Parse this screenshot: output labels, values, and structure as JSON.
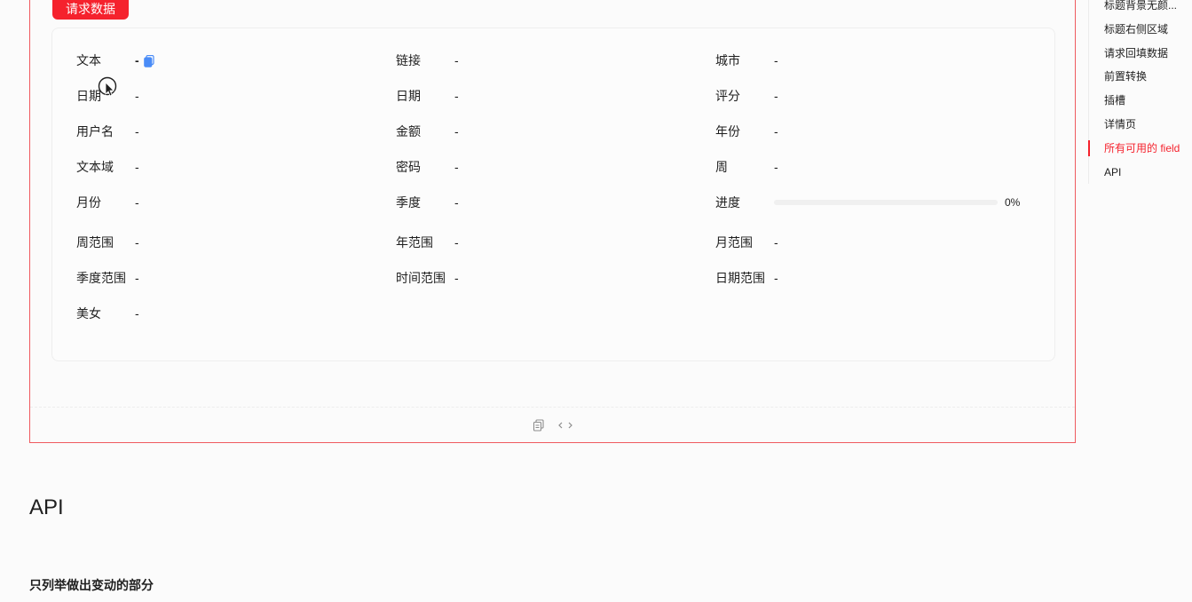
{
  "demo": {
    "request_button": "请求数据",
    "fields": [
      {
        "label": "文本",
        "value": "-"
      },
      {
        "label": "链接",
        "value": "-"
      },
      {
        "label": "城市",
        "value": "-"
      },
      {
        "label": "日期",
        "value": "-"
      },
      {
        "label": "日期",
        "value": "-"
      },
      {
        "label": "评分",
        "value": "-"
      },
      {
        "label": "用户名",
        "value": "-"
      },
      {
        "label": "金额",
        "value": "-"
      },
      {
        "label": "年份",
        "value": "-"
      },
      {
        "label": "文本域",
        "value": "-"
      },
      {
        "label": "密码",
        "value": "-"
      },
      {
        "label": "周",
        "value": "-"
      },
      {
        "label": "月份",
        "value": "-"
      },
      {
        "label": "季度",
        "value": "-"
      },
      {
        "label": "进度",
        "value": "0%"
      },
      {
        "label": "周范围",
        "value": "-"
      },
      {
        "label": "年范围",
        "value": "-"
      },
      {
        "label": "月范围",
        "value": "-"
      },
      {
        "label": "季度范围",
        "value": "-"
      },
      {
        "label": "时间范围",
        "value": "-"
      },
      {
        "label": "日期范围",
        "value": "-"
      },
      {
        "label": "美女",
        "value": "-"
      }
    ],
    "progress_percent": 0,
    "copy_icon": "copy-icon",
    "footer_icons": [
      "copy-icon",
      "code-icon"
    ]
  },
  "anchor_nav": {
    "items": [
      {
        "label": "标题背景无颜..."
      },
      {
        "label": "标题右侧区域"
      },
      {
        "label": "请求回填数据"
      },
      {
        "label": "前置转换"
      },
      {
        "label": "插槽"
      },
      {
        "label": "详情页"
      },
      {
        "label": "所有可用的 field"
      },
      {
        "label": "API"
      }
    ],
    "active_index": 6
  },
  "api_section": {
    "heading": "API",
    "description": "只列举做出变动的部分"
  },
  "colors": {
    "accent": "#f5222d",
    "frame_border": "#ef5a5f",
    "copy_icon": "#4a8cf7"
  }
}
